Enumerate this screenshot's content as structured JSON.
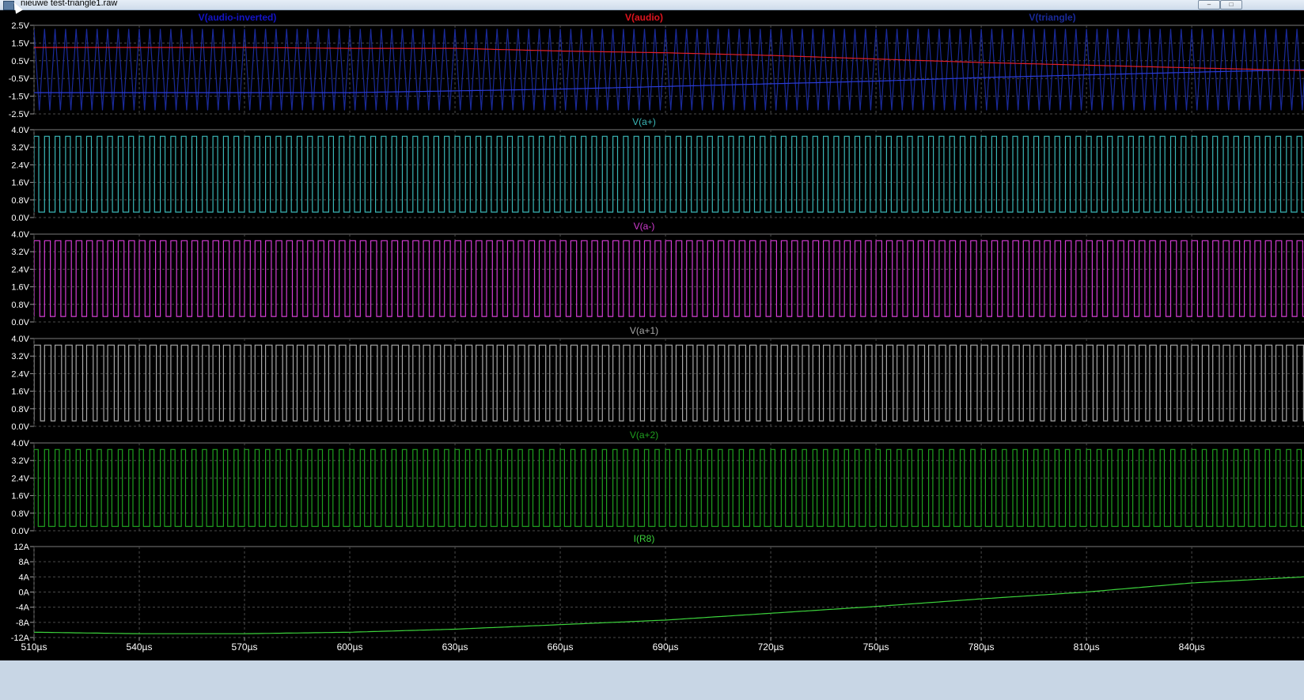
{
  "window": {
    "title": "nieuwe test-triangle1.raw",
    "buttons": [
      "‒",
      "□"
    ]
  },
  "x_axis": {
    "ticks": [
      "510µs",
      "540µs",
      "570µs",
      "600µs",
      "630µs",
      "660µs",
      "690µs",
      "720µs",
      "750µs",
      "780µs",
      "810µs",
      "840µs"
    ]
  },
  "chart_data": [
    {
      "type": "line",
      "title": "",
      "xlim": [
        510,
        872
      ],
      "x_unit": "µs",
      "ylim": [
        -2.5,
        2.5
      ],
      "yticks": [
        "2.5V",
        "1.5V",
        "0.5V",
        "-0.5V",
        "-1.5V",
        "-2.5V"
      ],
      "ytick_values": [
        2.5,
        1.5,
        0.5,
        -0.5,
        -1.5,
        -2.5
      ],
      "grid": true,
      "legend": [
        {
          "name": "V(audio-inverted)",
          "color": "#1414c8"
        },
        {
          "name": "V(audio)",
          "color": "#e0141e"
        },
        {
          "name": "V(triangle)",
          "color": "#1a2a9a"
        }
      ],
      "series": [
        {
          "name": "V(audio-inverted)",
          "color": "#2a3bd8",
          "kind": "smooth",
          "x": [
            510,
            540,
            570,
            600,
            630,
            660,
            690,
            720,
            750,
            780,
            810,
            840,
            872
          ],
          "y": [
            -1.3,
            -1.3,
            -1.3,
            -1.3,
            -1.2,
            -1.1,
            -0.95,
            -0.8,
            -0.65,
            -0.45,
            -0.3,
            -0.15,
            0.0
          ]
        },
        {
          "name": "V(audio)",
          "color": "#e01f28",
          "kind": "smooth",
          "x": [
            510,
            540,
            570,
            600,
            630,
            660,
            690,
            720,
            750,
            780,
            810,
            840,
            872
          ],
          "y": [
            1.25,
            1.25,
            1.25,
            1.2,
            1.2,
            1.05,
            0.95,
            0.8,
            0.6,
            0.4,
            0.25,
            0.1,
            -0.05
          ]
        },
        {
          "name": "V(triangle)",
          "color": "#1a2a9a",
          "kind": "triangle",
          "period": 3,
          "low": -2.3,
          "high": 2.3
        }
      ]
    },
    {
      "type": "line",
      "title": "V(a+)",
      "xlim": [
        510,
        872
      ],
      "ylim": [
        0,
        4.0
      ],
      "yticks": [
        "4.0V",
        "3.2V",
        "2.4V",
        "1.6V",
        "0.8V",
        "0.0V"
      ],
      "ytick_values": [
        4.0,
        3.2,
        2.4,
        1.6,
        0.8,
        0.0
      ],
      "grid": true,
      "series": [
        {
          "name": "V(a+)",
          "color": "#3ab6b6",
          "kind": "square",
          "period": 3,
          "low": 0.25,
          "high": 3.7,
          "duty": 0.45
        }
      ]
    },
    {
      "type": "line",
      "title": "V(a-)",
      "xlim": [
        510,
        872
      ],
      "ylim": [
        0,
        4.0
      ],
      "yticks": [
        "4.0V",
        "3.2V",
        "2.4V",
        "1.6V",
        "0.8V",
        "0.0V"
      ],
      "ytick_values": [
        4.0,
        3.2,
        2.4,
        1.6,
        0.8,
        0.0
      ],
      "grid": true,
      "series": [
        {
          "name": "V(a-)",
          "color": "#d23cd2",
          "kind": "square",
          "period": 3,
          "low": 0.25,
          "high": 3.7,
          "duty": 0.55
        }
      ]
    },
    {
      "type": "line",
      "title": "V(a+1)",
      "xlim": [
        510,
        872
      ],
      "ylim": [
        0,
        4.0
      ],
      "yticks": [
        "4.0V",
        "3.2V",
        "2.4V",
        "1.6V",
        "0.8V",
        "0.0V"
      ],
      "ytick_values": [
        4.0,
        3.2,
        2.4,
        1.6,
        0.8,
        0.0
      ],
      "grid": true,
      "series": [
        {
          "name": "V(a+1)",
          "color": "#a8a8a8",
          "kind": "square",
          "period": 3,
          "low": 0.25,
          "high": 3.7,
          "duty": 0.62
        }
      ]
    },
    {
      "type": "line",
      "title": "V(a+2)",
      "xlim": [
        510,
        872
      ],
      "ylim": [
        0,
        4.0
      ],
      "yticks": [
        "4.0V",
        "3.2V",
        "2.4V",
        "1.6V",
        "0.8V",
        "0.0V"
      ],
      "ytick_values": [
        4.0,
        3.2,
        2.4,
        1.6,
        0.8,
        0.0
      ],
      "grid": true,
      "series": [
        {
          "name": "V(a+2)",
          "color": "#1fa01f",
          "kind": "square",
          "period": 3,
          "low": 0.2,
          "high": 3.7,
          "duty": 0.4
        }
      ]
    },
    {
      "type": "line",
      "title": "I(R8)",
      "xlim": [
        510,
        872
      ],
      "ylim": [
        -12,
        12
      ],
      "yticks": [
        "12A",
        "8A",
        "4A",
        "0A",
        "-4A",
        "-8A",
        "-12A"
      ],
      "ytick_values": [
        12,
        8,
        4,
        0,
        -4,
        -8,
        -12
      ],
      "grid": true,
      "series": [
        {
          "name": "I(R8)",
          "color": "#3cd23c",
          "kind": "smooth",
          "x": [
            510,
            540,
            570,
            600,
            630,
            660,
            690,
            720,
            750,
            780,
            810,
            840,
            872
          ],
          "y": [
            -10.6,
            -11.0,
            -11.0,
            -10.6,
            -9.8,
            -8.6,
            -7.4,
            -5.6,
            -3.8,
            -1.8,
            0.0,
            2.4,
            4.0
          ]
        }
      ]
    }
  ],
  "colors": {
    "background": "#000000",
    "grid": "#4a4a4a",
    "axis_text": "#ffffff"
  }
}
